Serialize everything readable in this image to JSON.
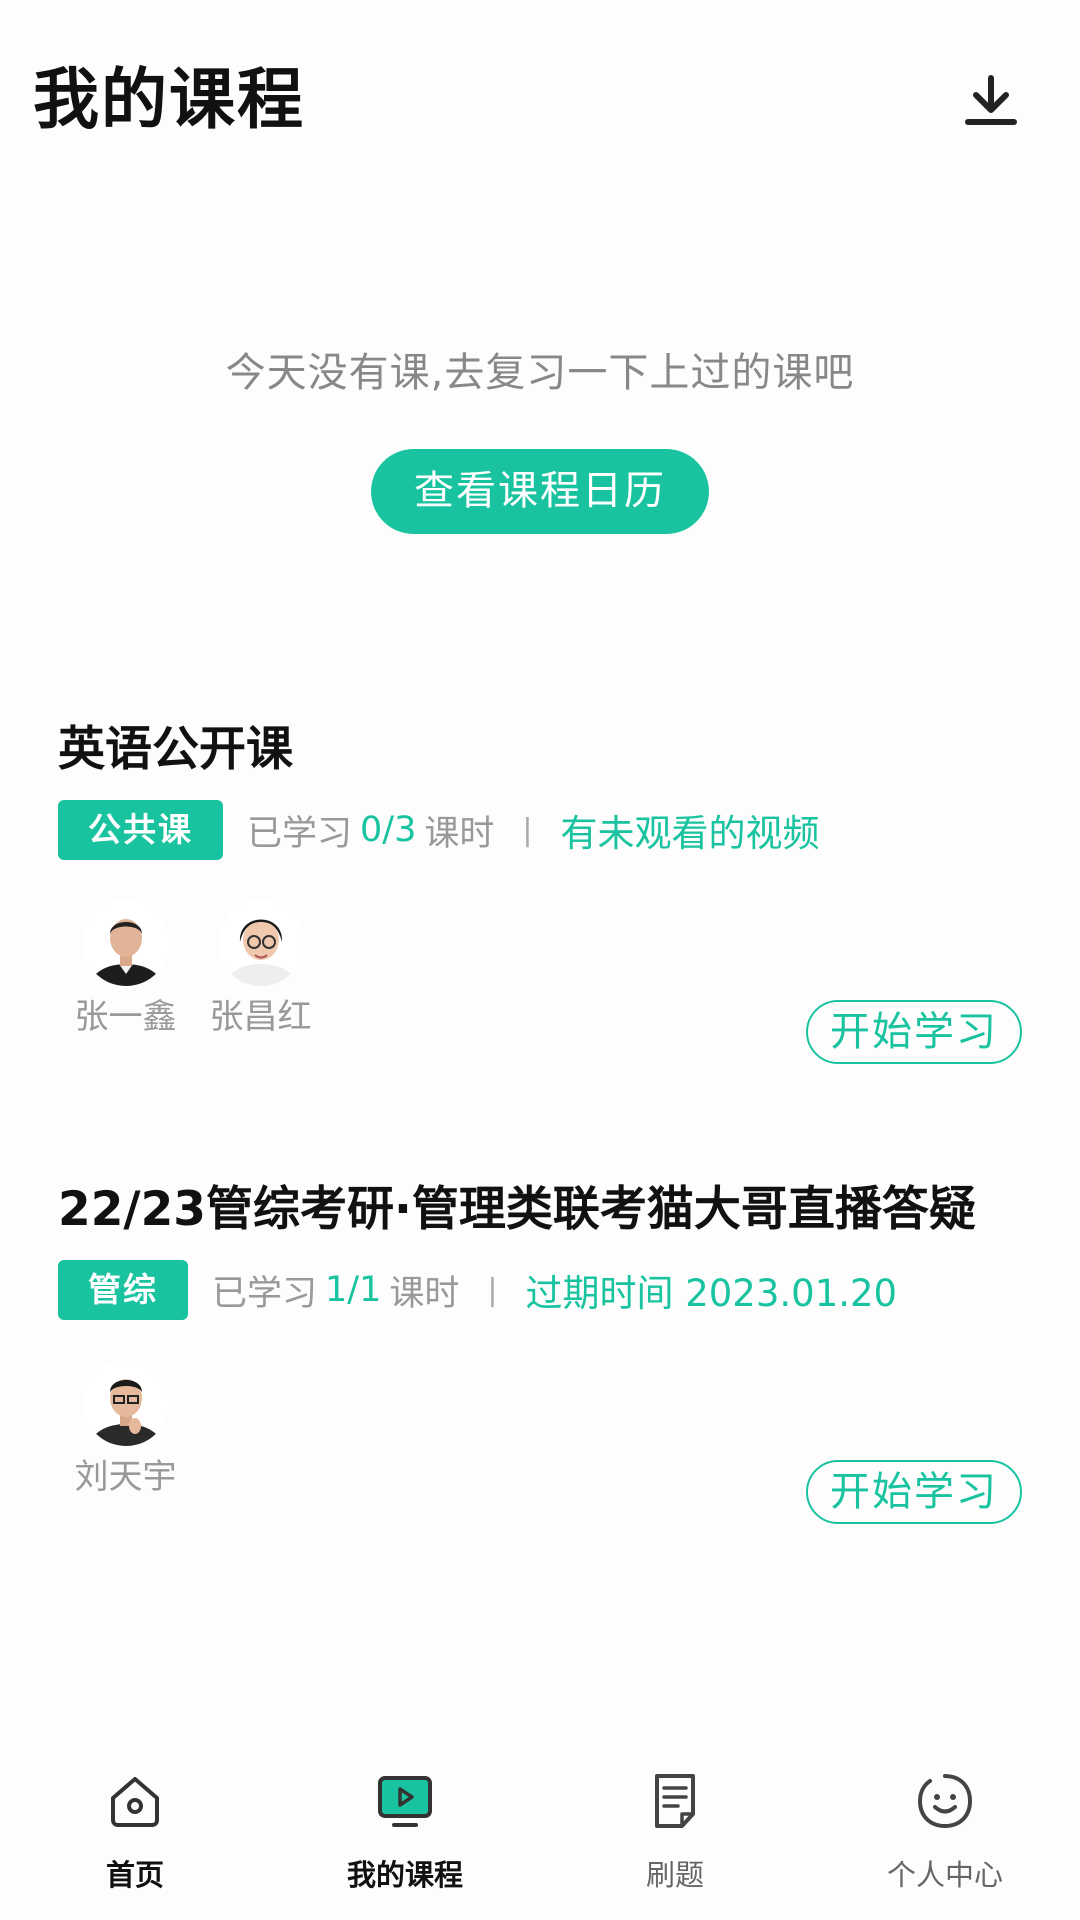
{
  "header": {
    "title": "我的课程"
  },
  "today": {
    "empty_text": "今天没有课,去复习一下上过的课吧",
    "calendar_button": "查看课程日历"
  },
  "courses": [
    {
      "title": "英语公开课",
      "tag": "公共课",
      "studied_label": "已学习",
      "progress": "0/3",
      "unit": "课时",
      "divider": "|",
      "note": "有未观看的视频",
      "teachers": [
        {
          "name": "张一鑫"
        },
        {
          "name": "张昌红"
        }
      ],
      "start_button": "开始学习"
    },
    {
      "title": "22/23管综考研·管理类联考猫大哥直播答疑",
      "tag": "管综",
      "studied_label": "已学习",
      "progress": "1/1",
      "unit": "课时",
      "divider": "|",
      "note": "过期时间 2023.01.20",
      "teachers": [
        {
          "name": "刘天宇"
        }
      ],
      "start_button": "开始学习"
    }
  ],
  "nav": {
    "items": [
      {
        "label": "首页",
        "icon": "home-icon"
      },
      {
        "label": "我的课程",
        "icon": "tv-play-icon"
      },
      {
        "label": "刷题",
        "icon": "note-icon"
      },
      {
        "label": "个人中心",
        "icon": "smiley-icon"
      }
    ],
    "active_index": 1
  },
  "colors": {
    "accent": "#19c3a0",
    "text_primary": "#111111",
    "text_secondary": "#999999"
  }
}
